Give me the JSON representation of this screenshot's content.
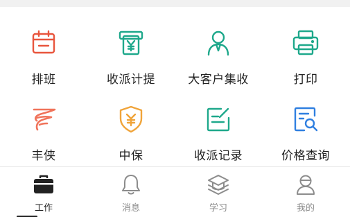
{
  "grid": {
    "items": [
      {
        "label": "排班",
        "icon": "calendar-schedule-icon",
        "color": "#e8553d"
      },
      {
        "label": "收派计提",
        "icon": "atm-yuan-icon",
        "color": "#1ea88b"
      },
      {
        "label": "大客户集收",
        "icon": "customer-person-icon",
        "color": "#1ea88b"
      },
      {
        "label": "打印",
        "icon": "printer-icon",
        "color": "#1ea88b"
      },
      {
        "label": "丰侠",
        "icon": "sf-logo-icon",
        "color": "#f0735a"
      },
      {
        "label": "中保",
        "icon": "shield-yuan-icon",
        "color": "#f0a43a"
      },
      {
        "label": "收派记录",
        "icon": "edit-record-icon",
        "color": "#1ea88b"
      },
      {
        "label": "价格查询",
        "icon": "price-search-icon",
        "color": "#2f7fe0"
      }
    ]
  },
  "tabbar": {
    "tabs": [
      {
        "label": "工作",
        "icon": "briefcase-icon",
        "active": true
      },
      {
        "label": "消息",
        "icon": "bell-icon",
        "active": false
      },
      {
        "label": "学习",
        "icon": "graduation-cap-icon",
        "active": false
      },
      {
        "label": "我的",
        "icon": "profile-icon",
        "active": false
      }
    ]
  },
  "colors": {
    "red": "#e8553d",
    "green": "#1ea88b",
    "orange": "#f0a43a",
    "blue": "#2f7fe0",
    "tab_inactive": "#8c8c8c",
    "tab_active": "#222222"
  }
}
